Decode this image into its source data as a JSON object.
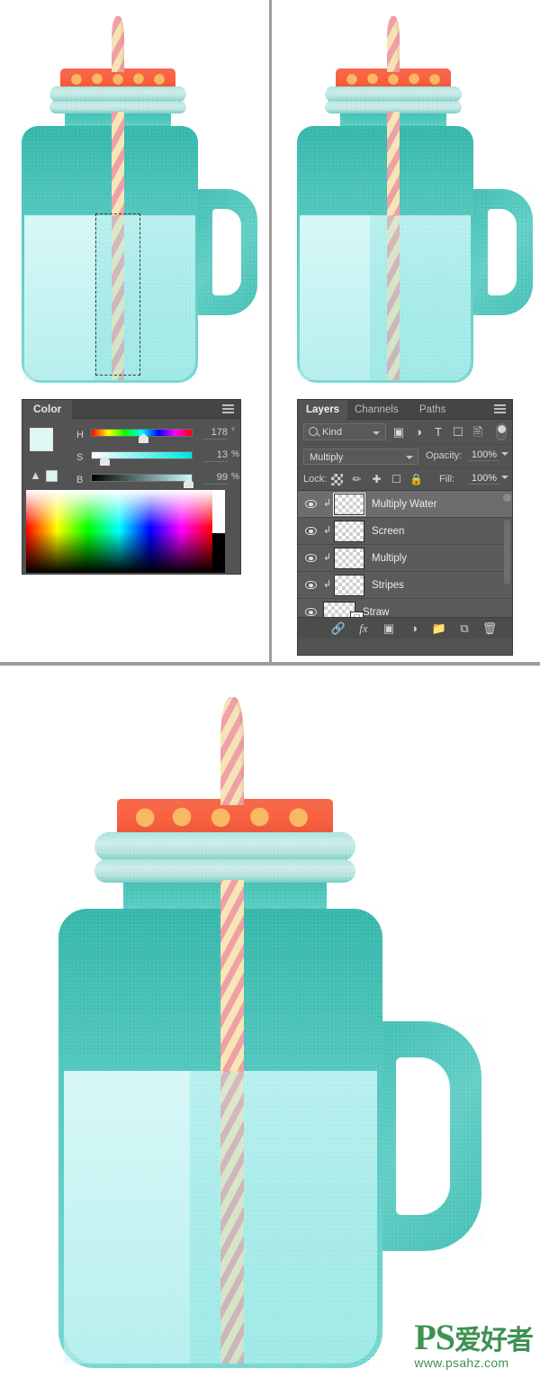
{
  "color_panel": {
    "tab_label": "Color",
    "menu_icon": "panel-menu-icon",
    "foreground_color": "#ddf7f5",
    "background_color": "#8ee2d8",
    "sliders": [
      {
        "label": "H",
        "value": "178",
        "unit": "°",
        "thumb_pct": 49
      },
      {
        "label": "S",
        "value": "13",
        "unit": "%",
        "thumb_pct": 13
      },
      {
        "label": "B",
        "value": "99",
        "unit": "%",
        "thumb_pct": 95
      }
    ],
    "gamut_warning_icon": "warning-triangle-icon"
  },
  "layers_panel": {
    "tabs": [
      {
        "label": "Layers",
        "active": true
      },
      {
        "label": "Channels",
        "active": false
      },
      {
        "label": "Paths",
        "active": false
      }
    ],
    "menu_icon": "panel-menu-icon",
    "filter": {
      "kind_label": "Kind",
      "search_icon": "search-icon",
      "icons": [
        "image-filter-icon",
        "adjustment-filter-icon",
        "type-filter-icon",
        "shape-filter-icon",
        "smart-object-filter-icon"
      ],
      "toggle_name": "filter-toggle"
    },
    "blend": {
      "mode": "Multiply",
      "opacity_label": "Opacity:",
      "opacity_value": "100%"
    },
    "lock": {
      "label": "Lock:",
      "icons": [
        "lock-transparency-icon",
        "lock-image-icon",
        "lock-position-icon",
        "lock-artboard-icon",
        "lock-all-icon"
      ],
      "fill_label": "Fill:",
      "fill_value": "100%"
    },
    "layers": [
      {
        "name": "Multiply Water",
        "selected": true,
        "clipped": true,
        "visible": true
      },
      {
        "name": "Screen",
        "selected": false,
        "clipped": true,
        "visible": true
      },
      {
        "name": "Multiply",
        "selected": false,
        "clipped": true,
        "visible": true
      },
      {
        "name": "Stripes",
        "selected": false,
        "clipped": true,
        "visible": true
      },
      {
        "name": "Straw",
        "selected": false,
        "clipped": false,
        "visible": true
      }
    ],
    "footer_icons": [
      "link-layers-icon",
      "layer-style-fx-icon",
      "add-mask-icon",
      "adjustment-layer-icon",
      "new-group-icon",
      "new-layer-icon",
      "delete-layer-icon"
    ]
  },
  "artwork": {
    "jar_body_color": "#4cc4ba",
    "water_color": "#a9ecea",
    "lid_color": "#f76a4e",
    "lid_dot_color": "#f7b964",
    "ring_color": "#b4e2dd",
    "straw_pink": "#efa0a7",
    "straw_cream": "#f7e5b6",
    "selection_present_step1": true
  },
  "watermark": {
    "brand": "PS",
    "brand_cn": "爱好者",
    "url": "www.psahz.com"
  }
}
